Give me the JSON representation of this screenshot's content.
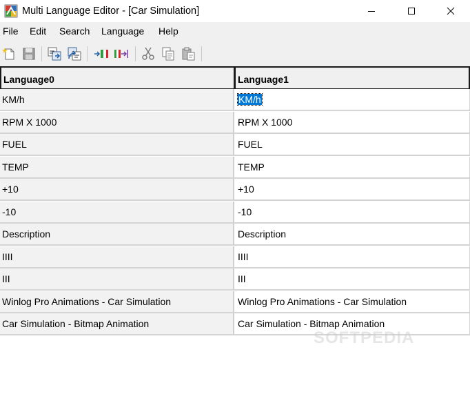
{
  "window": {
    "title": "Multi Language Editor - [Car Simulation]"
  },
  "menu": {
    "items": [
      {
        "label": "File"
      },
      {
        "label": "Edit"
      },
      {
        "label": "Search"
      },
      {
        "label": "Language"
      },
      {
        "label": "Help"
      }
    ]
  },
  "toolbar": {
    "icons": [
      "new-file-icon",
      "save-icon",
      "import-icon",
      "export-icon",
      "add-language-icon",
      "insert-language-icon",
      "cut-icon",
      "copy-icon",
      "paste-icon"
    ]
  },
  "table": {
    "columns": [
      "Language0",
      "Language1"
    ],
    "rows": [
      [
        "KM/h",
        "KM/h"
      ],
      [
        "RPM X 1000",
        "RPM X 1000"
      ],
      [
        "FUEL",
        "FUEL"
      ],
      [
        "TEMP",
        "TEMP"
      ],
      [
        "+10",
        "+10"
      ],
      [
        "-10",
        "-10"
      ],
      [
        "Description",
        "Description"
      ],
      [
        "IIII",
        "IIII"
      ],
      [
        "III",
        "III"
      ],
      [
        "Winlog Pro Animations - Car Simulation",
        "Winlog Pro Animations - Car Simulation"
      ],
      [
        "Car Simulation - Bitmap Animation",
        "Car Simulation - Bitmap Animation"
      ]
    ]
  },
  "watermark": "SOFTPEDIA",
  "colors": {
    "selection": "#0078d7",
    "menubar": "#f0f0f0",
    "first_column": "#f2f2f2"
  }
}
